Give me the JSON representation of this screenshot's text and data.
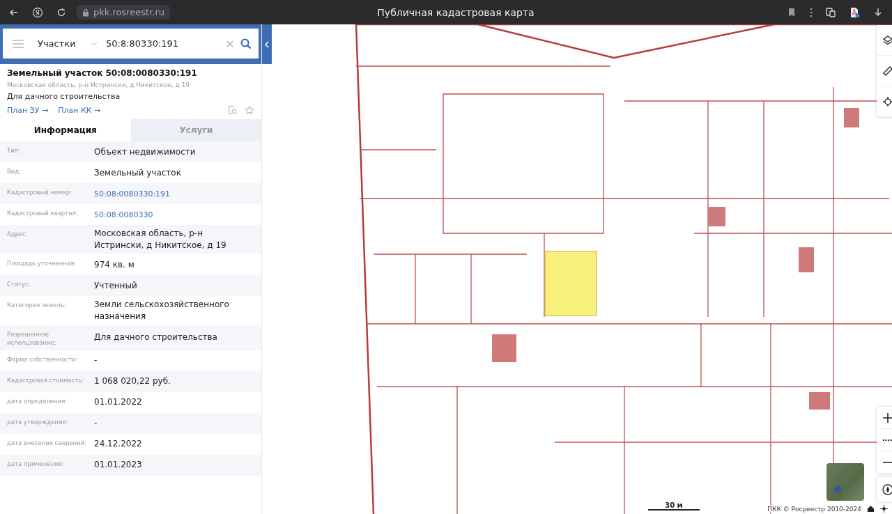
{
  "browser": {
    "url": "pkk.rosreestr.ru",
    "title": "Публичная кадастровая карта"
  },
  "search": {
    "category": "Участки",
    "value": "50:8:80330:191"
  },
  "object": {
    "title": "Земельный участок 50:08:0080330:191",
    "address": "Московская область, р-н Истрински, д Никитское, д 19",
    "purpose": "Для дачного строительства",
    "links": [
      "План ЗУ →",
      "План КК →"
    ]
  },
  "tabs": [
    {
      "label": "Информация",
      "selected": true
    },
    {
      "label": "Услуги",
      "selected": false
    }
  ],
  "fields": [
    {
      "label": "Тип:",
      "value": "Объект недвижимости",
      "kind": "text"
    },
    {
      "label": "Вид:",
      "value": "Земельный участок",
      "kind": "text"
    },
    {
      "label": "Кадастровый номер:",
      "value": "50:08:0080330:191",
      "kind": "link"
    },
    {
      "label": "Кадастровый квартал:",
      "value": "50:08:0080330",
      "kind": "link"
    },
    {
      "label": "Адрес:",
      "value": "Московская область, р-н Истрински, д Никитское, д 19",
      "kind": "text"
    },
    {
      "label": "Площадь уточненная:",
      "value": "974 кв. м",
      "kind": "text"
    },
    {
      "label": "Статус:",
      "value": "Учтенный",
      "kind": "text"
    },
    {
      "label": "Категория земель:",
      "value": "Земли сельскохозяйственного назначения",
      "kind": "text"
    },
    {
      "label": "Разрешенное использование:",
      "value": "Для дачного строительства",
      "kind": "text"
    },
    {
      "label": "Форма собственности:",
      "value": "-",
      "kind": "text"
    },
    {
      "label": "Кадастровая стоимость:",
      "value": "1 068 020,22 руб.",
      "kind": "text"
    },
    {
      "label": "дата определения:",
      "value": "01.01.2022",
      "kind": "text"
    },
    {
      "label": "дата утверждения:",
      "value": "-",
      "kind": "text"
    },
    {
      "label": "дата внесения сведений:",
      "value": "24.12.2022",
      "kind": "text"
    },
    {
      "label": "дата применения:",
      "value": "01.01.2023",
      "kind": "text"
    }
  ],
  "map": {
    "scale": "30 м",
    "attribution": "ПКК © Росреестр 2010-2024"
  }
}
